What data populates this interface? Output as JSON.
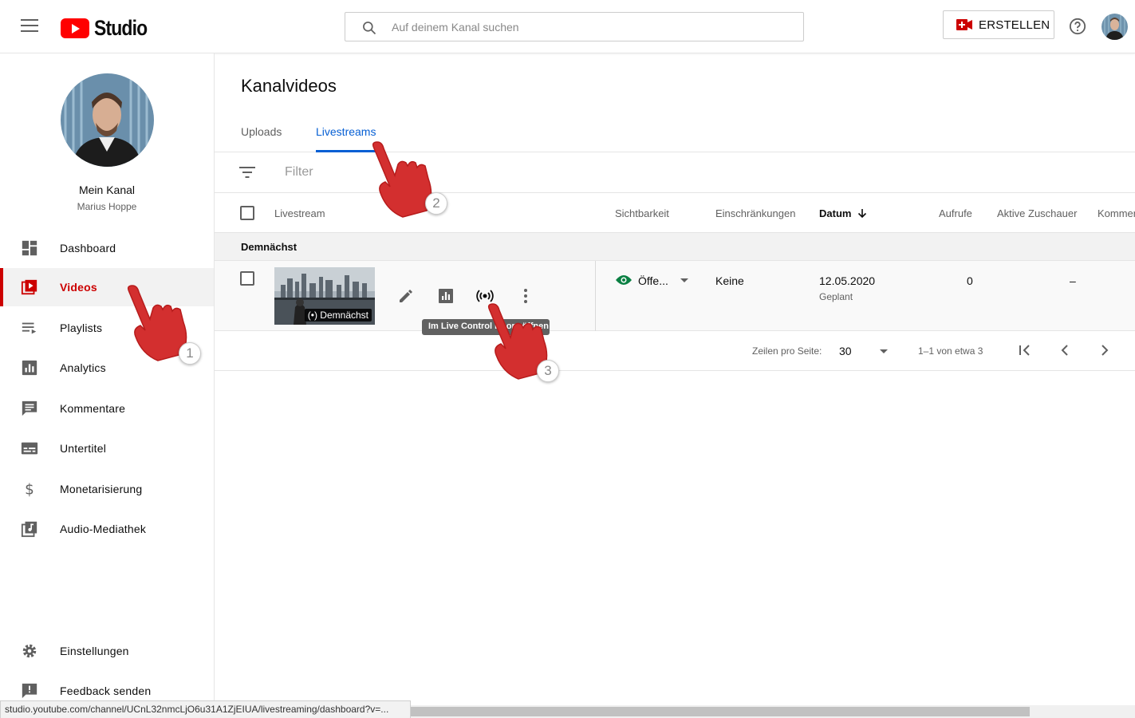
{
  "header": {
    "logo_text": "Studio",
    "search_placeholder": "Auf deinem Kanal suchen",
    "create_label": "ERSTELLEN"
  },
  "sidebar": {
    "channel_name": "Mein Kanal",
    "channel_owner": "Marius Hoppe",
    "items": [
      {
        "label": "Dashboard"
      },
      {
        "label": "Videos"
      },
      {
        "label": "Playlists"
      },
      {
        "label": "Analytics"
      },
      {
        "label": "Kommentare"
      },
      {
        "label": "Untertitel"
      },
      {
        "label": "Monetarisierung"
      },
      {
        "label": "Audio-Mediathek"
      }
    ],
    "bottom_items": [
      {
        "label": "Einstellungen"
      },
      {
        "label": "Feedback senden"
      }
    ]
  },
  "main": {
    "title": "Kanalvideos",
    "tabs": [
      {
        "label": "Uploads"
      },
      {
        "label": "Livestreams"
      }
    ],
    "filter_placeholder": "Filter",
    "columns": {
      "livestream": "Livestream",
      "visibility": "Sichtbarkeit",
      "restrictions": "Einschränkungen",
      "date": "Datum",
      "views": "Aufrufe",
      "active_viewers": "Aktive Zuschauer",
      "comments": "Kommentare"
    },
    "section_label": "Demnächst",
    "row": {
      "badge": "(•) Demnächst",
      "visibility": "Öffe...",
      "restrictions": "Keine",
      "date": "12.05.2020",
      "date_sub": "Geplant",
      "views": "0",
      "active_viewers": "–"
    },
    "tooltip": "Im Live Control Room öffnen",
    "pager": {
      "rows_label": "Zeilen pro Seite:",
      "rows_value": "30",
      "range": "1–1 von etwa 3"
    }
  },
  "steps": [
    "1",
    "2",
    "3"
  ],
  "status_bar": "studio.youtube.com/channel/UCnL32nmcLjO6u31A1ZjEIUA/livestreaming/dashboard?v=...",
  "colors": {
    "accent_red": "#cc0000",
    "tab_blue": "#065fd4",
    "visibility_green": "#0b8043",
    "hand_red": "#d32f2f"
  }
}
